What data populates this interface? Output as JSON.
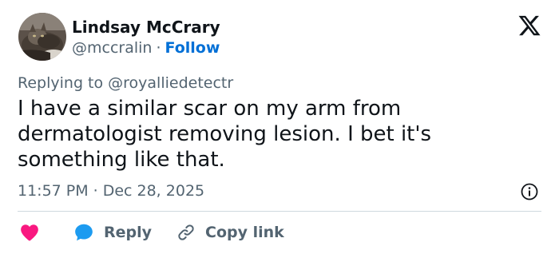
{
  "author": {
    "name": "Lindsay McCrary",
    "handle": "@mccralin",
    "separator": "·",
    "follow_label": "Follow",
    "avatar_icon": "cat-photo-avatar"
  },
  "brand": {
    "logo_icon": "x-logo-icon"
  },
  "tweet": {
    "replying_to": "Replying to @royalliedetectr",
    "text": "I have a similar scar on my arm from dermatologist removing lesion. I bet it's something like that.",
    "time": "11:57 PM",
    "separator": "·",
    "date": "Dec 28, 2025"
  },
  "actions": {
    "like_icon": "heart-icon",
    "reply_icon": "speech-bubble-icon",
    "reply_label": "Reply",
    "copy_icon": "link-icon",
    "copy_label": "Copy link",
    "info_icon": "info-icon"
  },
  "colors": {
    "like": "#f91880",
    "reply": "#1d9bf0",
    "follow": "#006fd6",
    "secondary_text": "#536471",
    "primary_text": "#0f1419",
    "divider": "#cfd9de"
  }
}
